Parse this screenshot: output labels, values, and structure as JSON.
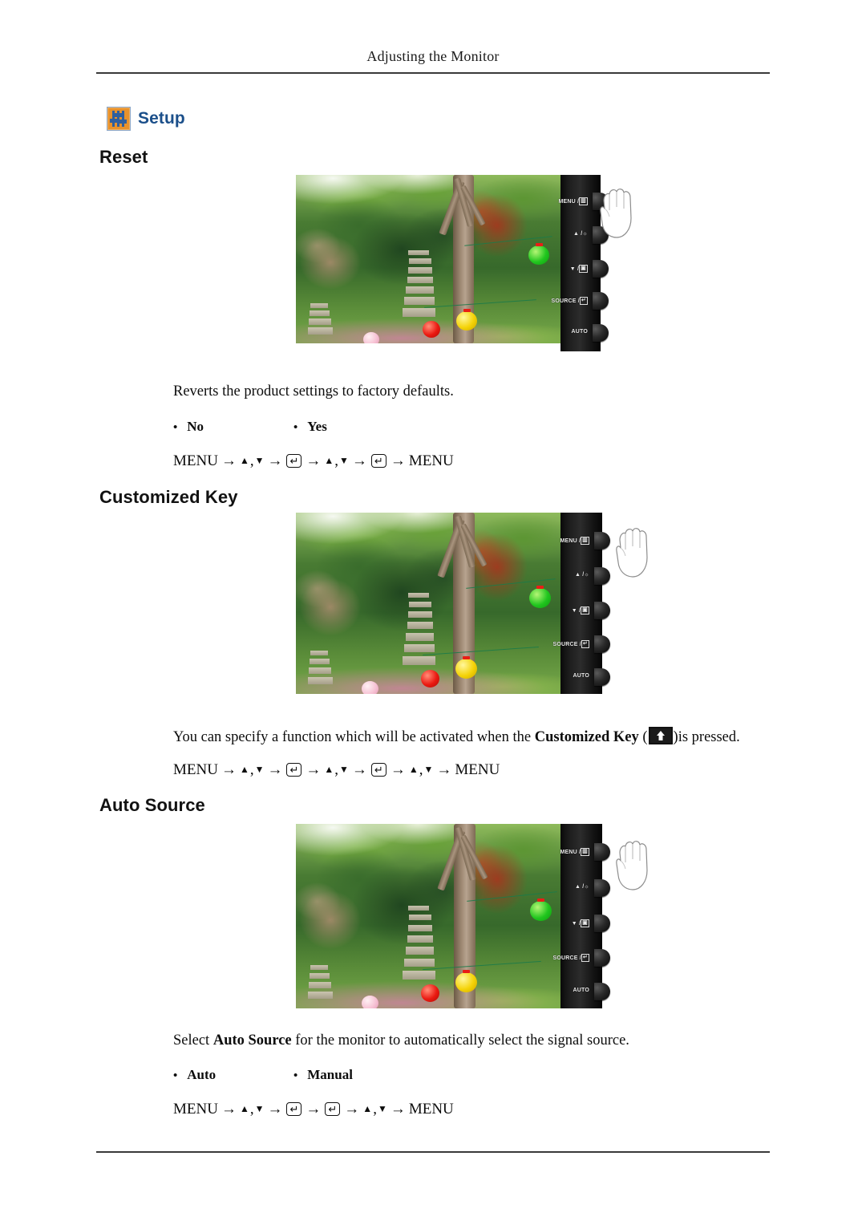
{
  "header": {
    "running_title": "Adjusting the Monitor"
  },
  "section": {
    "icon_name": "setup-sliders-icon",
    "title": "Setup",
    "title_color": "#1b4f8a",
    "icon_colors": {
      "background": "#e8922c",
      "sliders": "#2f5f9e",
      "border": "#8aa6c8"
    }
  },
  "topics": [
    {
      "heading": "Reset",
      "description": "Reverts the product settings to factory defaults.",
      "options": [
        "No",
        "Yes"
      ],
      "nav_path": "MENU → ▲ , ▼ → ↵ → ▲ , ▼ → ↵ → MENU"
    },
    {
      "heading": "Customized Key",
      "description_pre": "You can specify a function which will be activated when the ",
      "description_bold": "Customized Key",
      "description_mid": " (",
      "description_post": ")is pressed.",
      "nav_path": "MENU → ▲ , ▼ → ↵ → ▲ , ▼ → ↵ → ▲ , ▼ → MENU"
    },
    {
      "heading": "Auto Source",
      "description_pre": "Select ",
      "description_bold": "Auto Source",
      "description_post": " for the monitor to automatically select the signal source.",
      "options": [
        "Auto",
        "Manual"
      ],
      "nav_path": "MENU → ▲ , ▼ → ↵ → ↵ → ▲ , ▼ → MENU"
    }
  ],
  "monitor_panel": {
    "buttons": [
      {
        "label": "MENU /",
        "glyph": "▥",
        "name": "menu-button"
      },
      {
        "label": "▲ /",
        "glyph": "☼",
        "name": "up-brightness-button"
      },
      {
        "label": "▼ /",
        "glyph": "▣",
        "name": "down-mode-button"
      },
      {
        "label": "SOURCE /",
        "glyph": "↵",
        "name": "source-enter-button"
      },
      {
        "label": "AUTO",
        "glyph": "",
        "name": "auto-button"
      }
    ],
    "cursor": "pressing-hand-icon"
  },
  "screen_image": {
    "alt": "Korean temple garden with stone pagodas, green trees and colored paper lanterns",
    "lanterns": [
      "green",
      "red",
      "yellow",
      "pink"
    ]
  },
  "nav_tokens": {
    "menu": "MENU",
    "arrow": "→",
    "up": "▲",
    "down": "▼",
    "comma": ",",
    "enter": "↵"
  },
  "bullet_char": "•"
}
